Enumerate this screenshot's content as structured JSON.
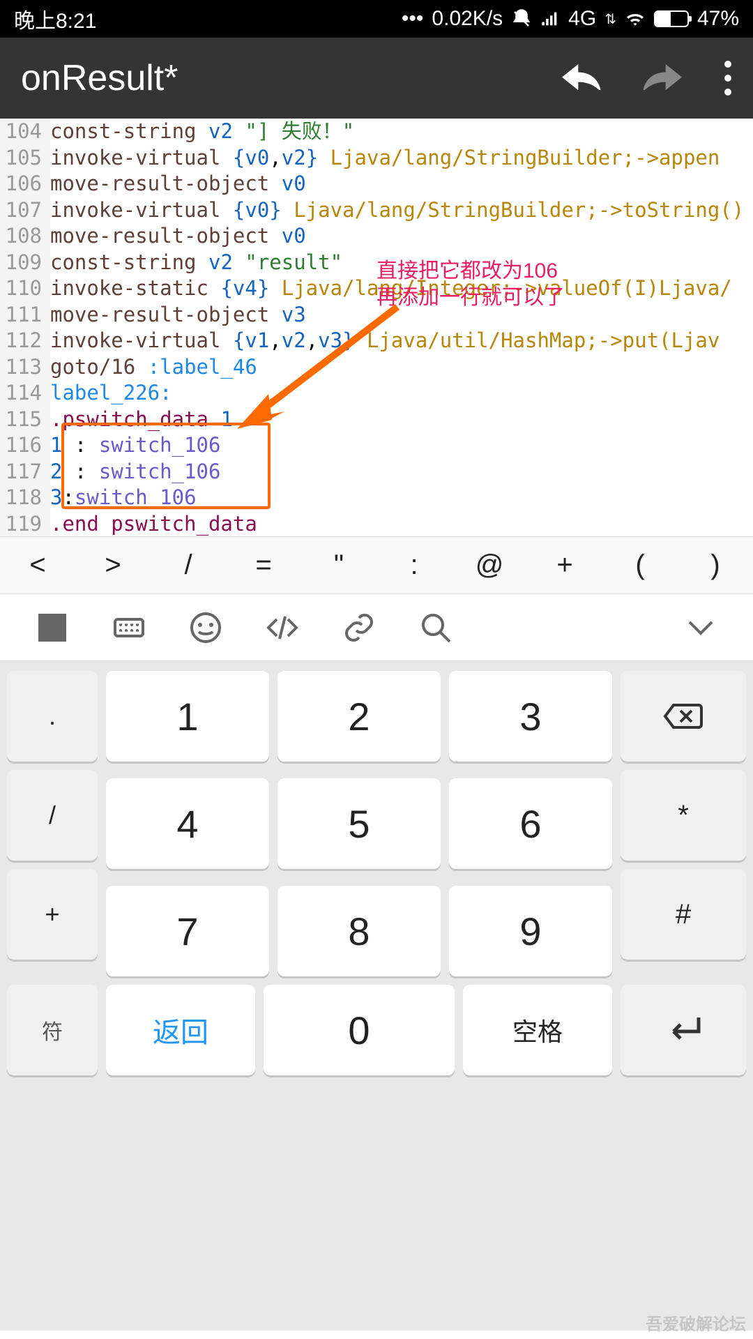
{
  "status": {
    "time": "晚上8:21",
    "speed": "0.02K/s",
    "network": "4G",
    "battery": "47%"
  },
  "appbar": {
    "title": "onResult*"
  },
  "code": {
    "lines": [
      {
        "n": "104",
        "seg": [
          {
            "c": "tk-kw",
            "t": "const-string "
          },
          {
            "c": "tk-reg",
            "t": "v2"
          },
          {
            "c": "",
            "t": " "
          },
          {
            "c": "tk-str",
            "t": "\"] 失败！\""
          }
        ]
      },
      {
        "n": "105",
        "seg": [
          {
            "c": "tk-kw",
            "t": "invoke-virtual "
          },
          {
            "c": "tk-br",
            "t": "{"
          },
          {
            "c": "tk-reg",
            "t": "v0"
          },
          {
            "c": "",
            "t": ","
          },
          {
            "c": "tk-reg",
            "t": "v2"
          },
          {
            "c": "tk-br",
            "t": "}"
          },
          {
            "c": "",
            "t": " "
          },
          {
            "c": "tk-type",
            "t": "Ljava/lang/StringBuilder;->appen"
          }
        ]
      },
      {
        "n": "106",
        "seg": [
          {
            "c": "tk-kw",
            "t": "move-result-object "
          },
          {
            "c": "tk-reg",
            "t": "v0"
          }
        ]
      },
      {
        "n": "107",
        "seg": [
          {
            "c": "tk-kw",
            "t": "invoke-virtual "
          },
          {
            "c": "tk-br",
            "t": "{"
          },
          {
            "c": "tk-reg",
            "t": "v0"
          },
          {
            "c": "tk-br",
            "t": "}"
          },
          {
            "c": "",
            "t": " "
          },
          {
            "c": "tk-type",
            "t": "Ljava/lang/StringBuilder;->toString()"
          }
        ]
      },
      {
        "n": "108",
        "seg": [
          {
            "c": "tk-kw",
            "t": "move-result-object "
          },
          {
            "c": "tk-reg",
            "t": "v0"
          }
        ]
      },
      {
        "n": "109",
        "seg": [
          {
            "c": "tk-kw",
            "t": "const-string "
          },
          {
            "c": "tk-reg",
            "t": "v2"
          },
          {
            "c": "",
            "t": " "
          },
          {
            "c": "tk-str",
            "t": "\"result\""
          }
        ]
      },
      {
        "n": "110",
        "seg": [
          {
            "c": "tk-kw",
            "t": "invoke-static "
          },
          {
            "c": "tk-br",
            "t": "{"
          },
          {
            "c": "tk-reg",
            "t": "v4"
          },
          {
            "c": "tk-br",
            "t": "}"
          },
          {
            "c": "",
            "t": " "
          },
          {
            "c": "tk-type",
            "t": "Ljava/lang/Integer;->valueOf(I)Ljava/"
          }
        ]
      },
      {
        "n": "111",
        "seg": [
          {
            "c": "tk-kw",
            "t": "move-result-object "
          },
          {
            "c": "tk-reg",
            "t": "v3"
          }
        ]
      },
      {
        "n": "112",
        "seg": [
          {
            "c": "tk-kw",
            "t": "invoke-virtual "
          },
          {
            "c": "tk-br",
            "t": "{"
          },
          {
            "c": "tk-reg",
            "t": "v1"
          },
          {
            "c": "",
            "t": ","
          },
          {
            "c": "tk-reg",
            "t": "v2"
          },
          {
            "c": "",
            "t": ","
          },
          {
            "c": "tk-reg",
            "t": "v3"
          },
          {
            "c": "tk-br",
            "t": "}"
          },
          {
            "c": "",
            "t": " "
          },
          {
            "c": "tk-type",
            "t": "Ljava/util/HashMap;->put(Ljav"
          }
        ]
      },
      {
        "n": "113",
        "seg": [
          {
            "c": "tk-kw",
            "t": "goto/16 "
          },
          {
            "c": "tk-label",
            "t": ":label_46"
          }
        ]
      },
      {
        "n": "114",
        "seg": [
          {
            "c": "tk-label",
            "t": "label_226:"
          }
        ]
      },
      {
        "n": "115",
        "seg": [
          {
            "c": "tk-dir",
            "t": ".pswitch_data "
          },
          {
            "c": "tk-num",
            "t": "1"
          }
        ]
      },
      {
        "n": "116",
        "seg": [
          {
            "c": "",
            "t": "   "
          },
          {
            "c": "tk-num",
            "t": "1"
          },
          {
            "c": "",
            "t": " : "
          },
          {
            "c": "tk-sw",
            "t": "switch_106"
          }
        ]
      },
      {
        "n": "117",
        "seg": [
          {
            "c": "",
            "t": "   "
          },
          {
            "c": "tk-num",
            "t": "2"
          },
          {
            "c": "",
            "t": " : "
          },
          {
            "c": "tk-sw",
            "t": "switch_106"
          }
        ]
      },
      {
        "n": "118",
        "seg": [
          {
            "c": "",
            "t": "   "
          },
          {
            "c": "tk-num",
            "t": "3"
          },
          {
            "c": "",
            "t": ":"
          },
          {
            "c": "tk-sw",
            "t": "switch_106"
          }
        ]
      },
      {
        "n": "119",
        "seg": [
          {
            "c": "tk-dir",
            "t": ".end pswitch_data"
          }
        ]
      }
    ]
  },
  "annotation": {
    "line1": "直接把它都改为106",
    "line2": "再添加一行就可以了"
  },
  "symbol_row": [
    "<",
    ">",
    "/",
    "=",
    "\"",
    ":",
    "@",
    "+",
    "(",
    ")"
  ],
  "keyboard": {
    "side_left": [
      ".",
      "/",
      "+"
    ],
    "row1": [
      "1",
      "2",
      "3"
    ],
    "row2": [
      "4",
      "5",
      "6"
    ],
    "row3": [
      "7",
      "8",
      "9"
    ],
    "row4_num": "0",
    "bottom": {
      "sym": "符",
      "back": "返回",
      "space": "空格"
    },
    "right": {
      "del": "⌫",
      "star": "*",
      "hash": "#",
      "enter": "↵"
    }
  },
  "watermark": "吾爱破解论坛"
}
